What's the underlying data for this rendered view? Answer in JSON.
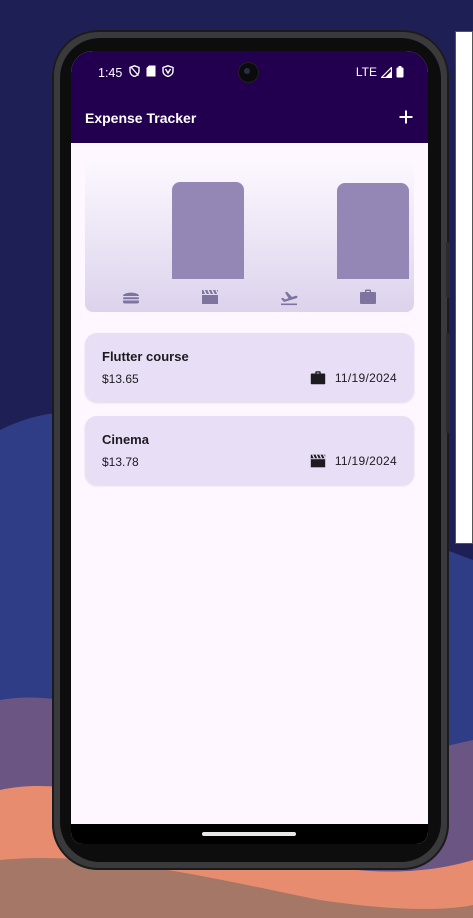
{
  "status_bar": {
    "time": "1:45",
    "network": "LTE",
    "left_icons": [
      "privacy-shield-icon",
      "sim-card-icon",
      "vpn-icon"
    ],
    "right_icons": [
      "signal-icon",
      "battery-icon"
    ]
  },
  "app_bar": {
    "title": "Expense Tracker",
    "add_icon": "add-icon"
  },
  "chart_data": {
    "type": "bar",
    "categories": [
      "food",
      "leisure",
      "travel",
      "work"
    ],
    "category_icons": [
      "burger-icon",
      "movie-clapper-icon",
      "flight-takeoff-icon",
      "work-briefcase-icon"
    ],
    "values": [
      0,
      13.78,
      0,
      13.65
    ],
    "bar_color": "#9587b5",
    "grid": false
  },
  "expenses": [
    {
      "title": "Flutter course",
      "amount": "$13.65",
      "category_icon": "work-briefcase-icon",
      "date": "11/19/2024"
    },
    {
      "title": "Cinema",
      "amount": "$13.78",
      "category_icon": "movie-clapper-icon",
      "date": "11/19/2024"
    }
  ],
  "colors": {
    "app_bar": "#23004f",
    "screen_bg": "#fef7ff",
    "card_bg": "#e8dff6",
    "bar": "#9587b5"
  }
}
